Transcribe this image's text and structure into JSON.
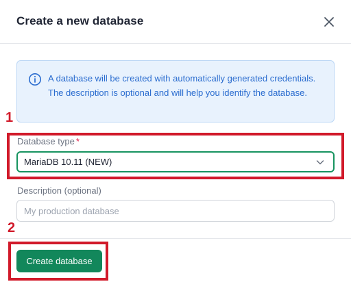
{
  "dialog": {
    "title": "Create a new database",
    "close_icon": "close-icon"
  },
  "info": {
    "icon": "info-icon",
    "text": "A database will be created with automatically generated credentials. The description is optional and will help you identify the database."
  },
  "form": {
    "type_label": "Database type",
    "required_mark": "*",
    "type_value": "MariaDB 10.11 (NEW)",
    "type_icon": "chevron-down-icon",
    "description_label": "Description (optional)",
    "description_value": "",
    "description_placeholder": "My production database"
  },
  "footer": {
    "submit_label": "Create database"
  },
  "annotations": {
    "step1": "1",
    "step2": "2"
  },
  "colors": {
    "brand": "#12875b",
    "annotation": "#d11a2a",
    "info_bg": "#e8f2fd",
    "info_text": "#2a6ccf"
  }
}
